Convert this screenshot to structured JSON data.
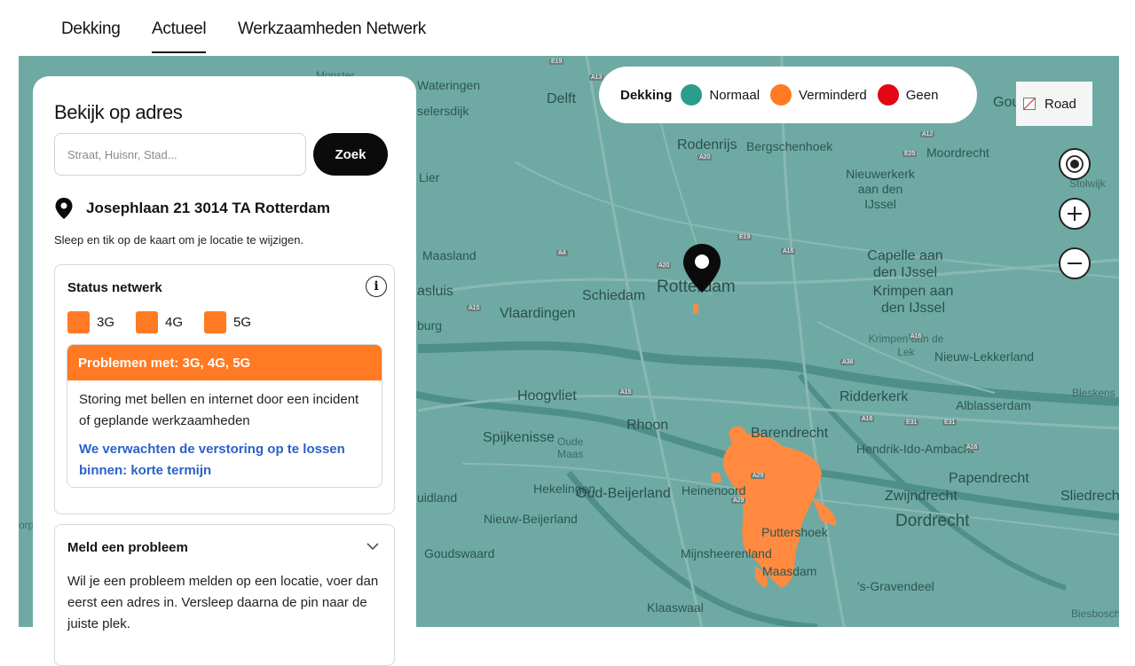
{
  "tabs": [
    {
      "label": "Dekking",
      "active": false
    },
    {
      "label": "Actueel",
      "active": true
    },
    {
      "label": "Werkzaamheden Netwerk",
      "active": false
    }
  ],
  "legend": {
    "title": "Dekking",
    "items": [
      {
        "label": "Normaal",
        "color": "#2a9d8f"
      },
      {
        "label": "Verminderd",
        "color": "#ff7a22"
      },
      {
        "label": "Geen",
        "color": "#e30613"
      }
    ]
  },
  "map_type_button": "Road",
  "map_labels": [
    "Monster",
    "Wateringen",
    "Delft",
    "Gouda",
    "selersdijk",
    "Rodenrijs",
    "Bergschenhoek",
    "Moordrecht",
    "Lier",
    "Nieuwerkerk aan den IJssel",
    "Stolwijk",
    "Maasland",
    "Capelle aan den IJssel",
    "Krimpen aan den IJssel",
    "Schiedam",
    "Rotterdam",
    "asluis",
    "Vlaardingen",
    "Krimpen aan de Lek",
    "Nieuw-Lekkerland",
    "Hoogvliet",
    "Ridderkerk",
    "Bleskens",
    "Alblasserdam",
    "Rhoon",
    "Barendrecht",
    "Spijkenisse",
    "Oude Maas",
    "Hendrik-Ido-Ambacht",
    "Papendrecht",
    "Hekelingen",
    "Oud-Beijerland",
    "Heinenoord",
    "Zwijndrecht",
    "Sliedrecht",
    "Dordrecht",
    "Nieuw-Beijerland",
    "Puttershoek",
    "Goudswaard",
    "Mijnsheerenland",
    "Maasdam",
    "'s-Gravendeel",
    "Klaaswaal",
    "Biesbosch",
    "burg",
    "uidland",
    "orp"
  ],
  "road_shields": [
    "E19",
    "A13",
    "A12",
    "A20",
    "E25",
    "A4",
    "E19",
    "A16",
    "A20",
    "A15",
    "A15",
    "A16",
    "A38",
    "A29",
    "E31",
    "A16",
    "E31",
    "A16",
    "A29"
  ],
  "search": {
    "title": "Bekijk op adres",
    "placeholder": "Straat, Huisnr, Stad...",
    "button": "Zoek"
  },
  "address": {
    "value": "Josephlaan 21 3014 TA Rotterdam",
    "hint": "Sleep en tik op de kaart om je locatie te wijzigen."
  },
  "status": {
    "title": "Status netwerk",
    "networks": [
      "3G",
      "4G",
      "5G"
    ],
    "problem_header": "Problemen met: 3G, 4G, 5G",
    "problem_text": "Storing met bellen en internet door een incident of geplande werkzaamheden",
    "problem_link": "We verwachten de verstoring op te lossen binnen: korte termijn"
  },
  "report": {
    "title": "Meld een probleem",
    "text": "Wil je een probleem melden op een locatie, voer dan eerst een adres in. Versleep daarna de pin naar de juiste plek."
  }
}
